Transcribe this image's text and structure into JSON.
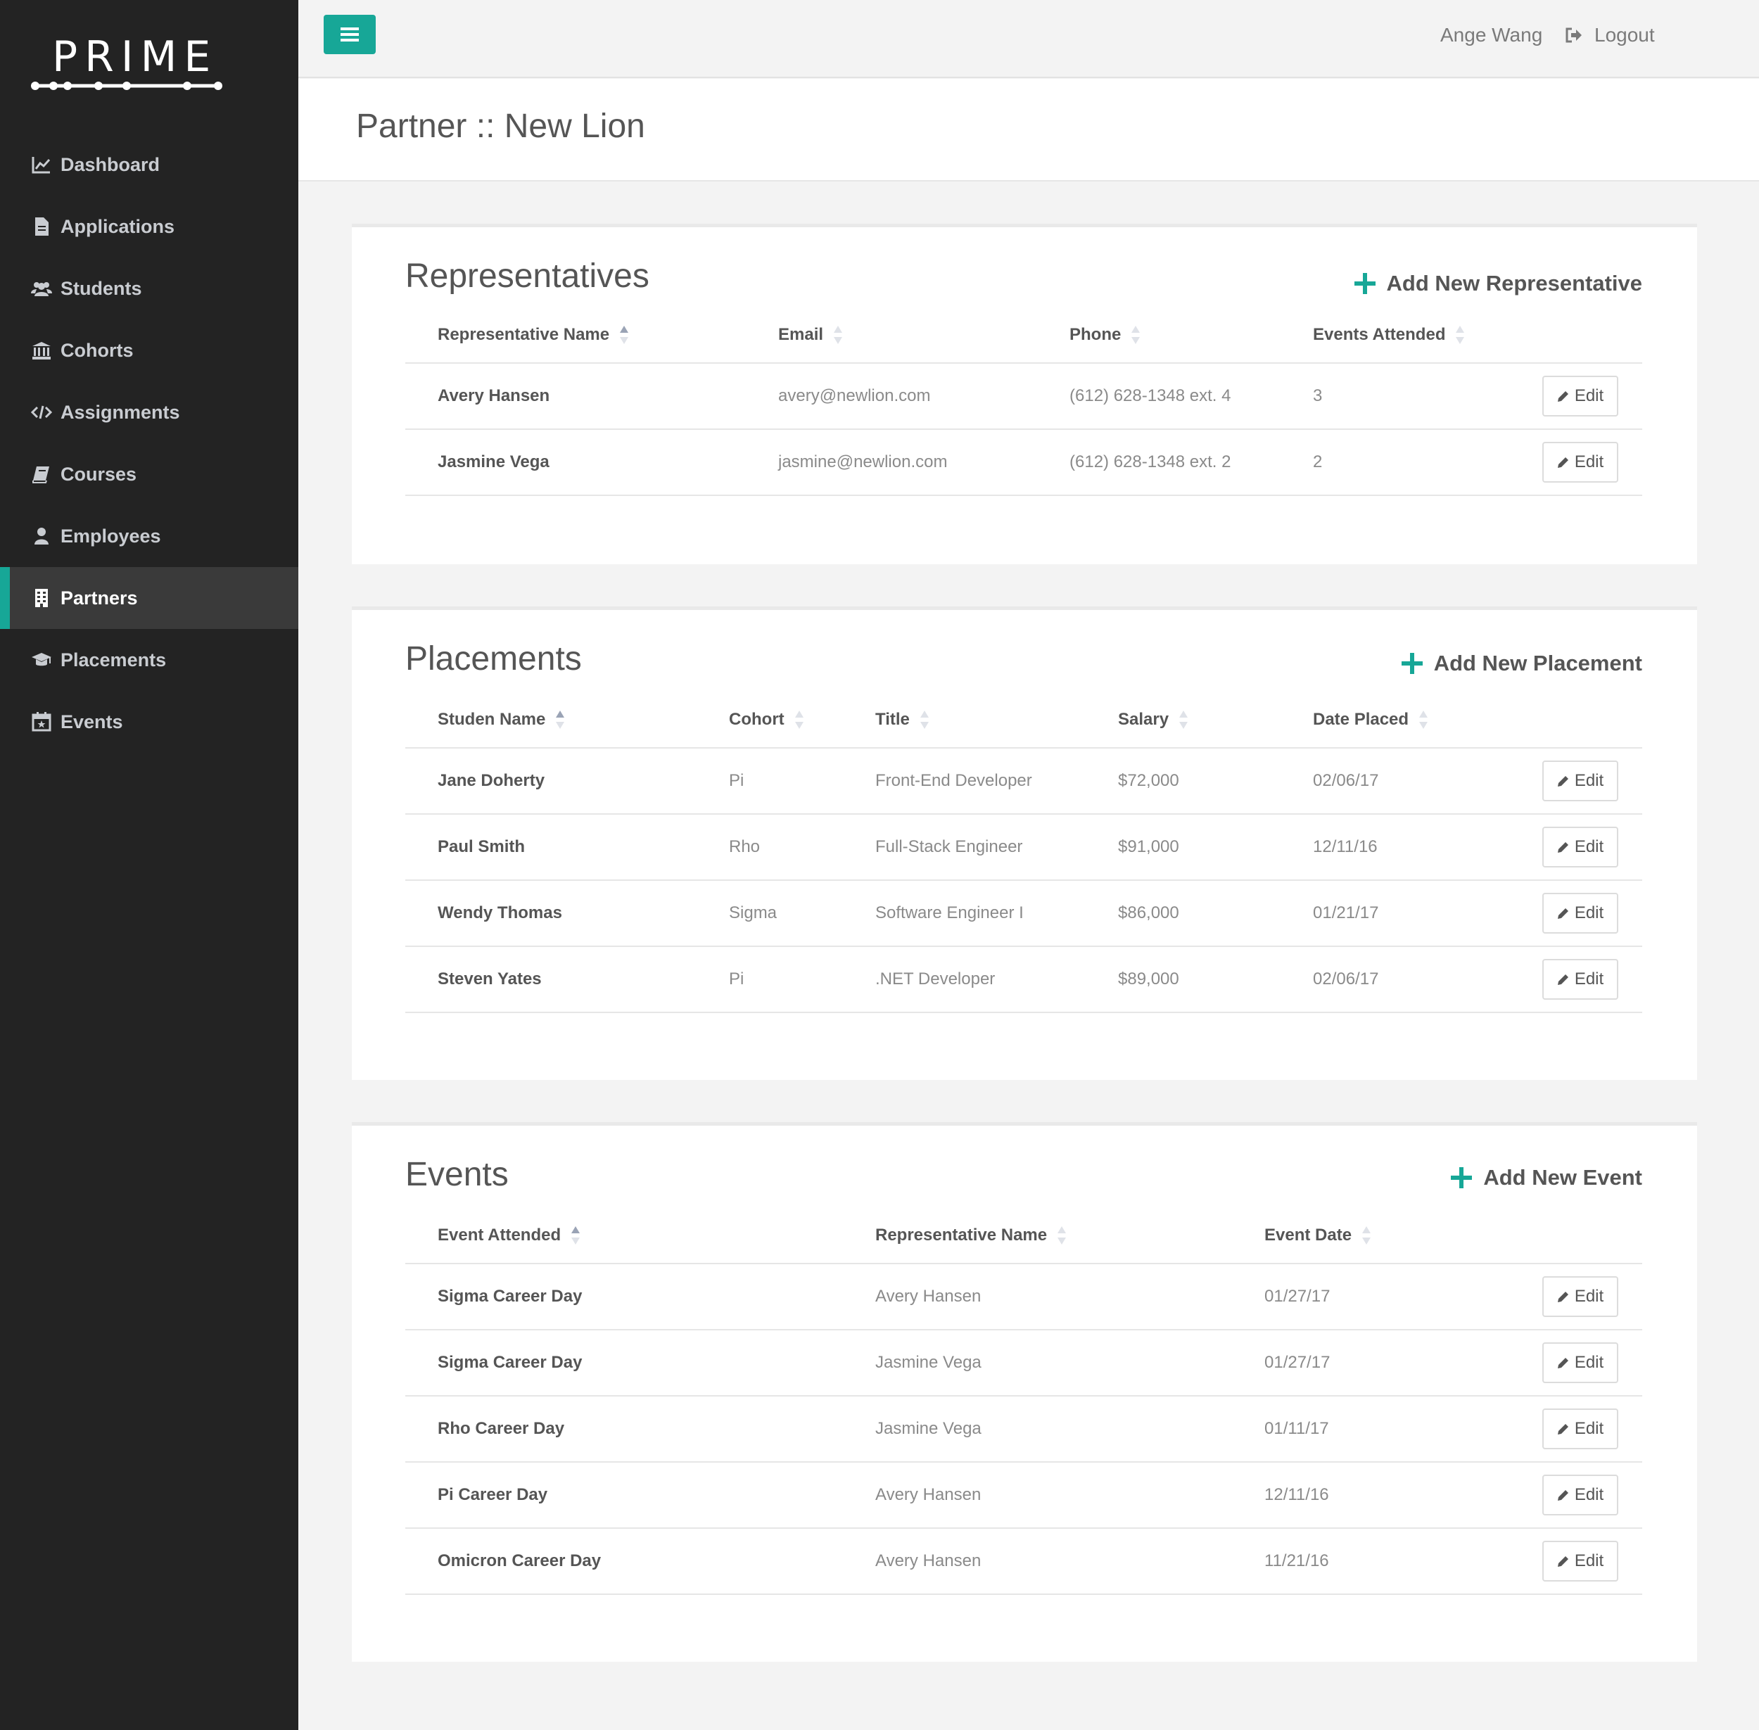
{
  "brand": {
    "logo_text": "PRIME"
  },
  "sidebar": {
    "items": [
      {
        "label": "Dashboard",
        "icon": "chart-icon"
      },
      {
        "label": "Applications",
        "icon": "file-icon"
      },
      {
        "label": "Students",
        "icon": "users-icon"
      },
      {
        "label": "Cohorts",
        "icon": "institution-icon"
      },
      {
        "label": "Assignments",
        "icon": "code-icon"
      },
      {
        "label": "Courses",
        "icon": "book-icon"
      },
      {
        "label": "Employees",
        "icon": "user-icon"
      },
      {
        "label": "Partners",
        "icon": "building-icon",
        "active": true
      },
      {
        "label": "Placements",
        "icon": "graduation-cap-icon"
      },
      {
        "label": "Events",
        "icon": "calendar-icon"
      }
    ]
  },
  "header": {
    "menu_icon": "hamburger-icon",
    "user_name": "Ange Wang",
    "logout_label": "Logout",
    "logout_icon": "sign-out-icon"
  },
  "page": {
    "title": "Partner :: New Lion"
  },
  "accent_color": "#17a797",
  "representatives": {
    "title": "Representatives",
    "add_label": "Add New Representative",
    "columns": [
      "Representative Name",
      "Email",
      "Phone",
      "Events Attended"
    ],
    "rows": [
      {
        "name": "Avery Hansen",
        "email": "avery@newlion.com",
        "phone": "(612) 628-1348 ext. 4",
        "events": "3"
      },
      {
        "name": "Jasmine Vega",
        "email": "jasmine@newlion.com",
        "phone": "(612) 628-1348 ext. 2",
        "events": "2"
      }
    ],
    "edit_label": "Edit"
  },
  "placements": {
    "title": "Placements",
    "add_label": "Add New Placement",
    "columns": [
      "Studen Name",
      "Cohort",
      "Title",
      "Salary",
      "Date Placed"
    ],
    "rows": [
      {
        "name": "Jane Doherty",
        "cohort": "Pi",
        "title": "Front-End Developer",
        "salary": "$72,000",
        "date": "02/06/17"
      },
      {
        "name": "Paul Smith",
        "cohort": "Rho",
        "title": "Full-Stack Engineer",
        "salary": "$91,000",
        "date": "12/11/16"
      },
      {
        "name": "Wendy Thomas",
        "cohort": "Sigma",
        "title": "Software Engineer I",
        "salary": "$86,000",
        "date": "01/21/17"
      },
      {
        "name": "Steven Yates",
        "cohort": "Pi",
        "title": ".NET Developer",
        "salary": "$89,000",
        "date": "02/06/17"
      }
    ],
    "edit_label": "Edit"
  },
  "events": {
    "title": "Events",
    "add_label": "Add New Event",
    "columns": [
      "Event Attended",
      "Representative Name",
      "Event Date"
    ],
    "rows": [
      {
        "event": "Sigma Career Day",
        "rep": "Avery Hansen",
        "date": "01/27/17"
      },
      {
        "event": "Sigma Career Day",
        "rep": "Jasmine Vega",
        "date": "01/27/17"
      },
      {
        "event": "Rho Career Day",
        "rep": "Jasmine Vega",
        "date": "01/11/17"
      },
      {
        "event": "Pi Career Day",
        "rep": "Avery Hansen",
        "date": "12/11/16"
      },
      {
        "event": "Omicron Career Day",
        "rep": "Avery Hansen",
        "date": "11/21/16"
      }
    ],
    "edit_label": "Edit"
  }
}
